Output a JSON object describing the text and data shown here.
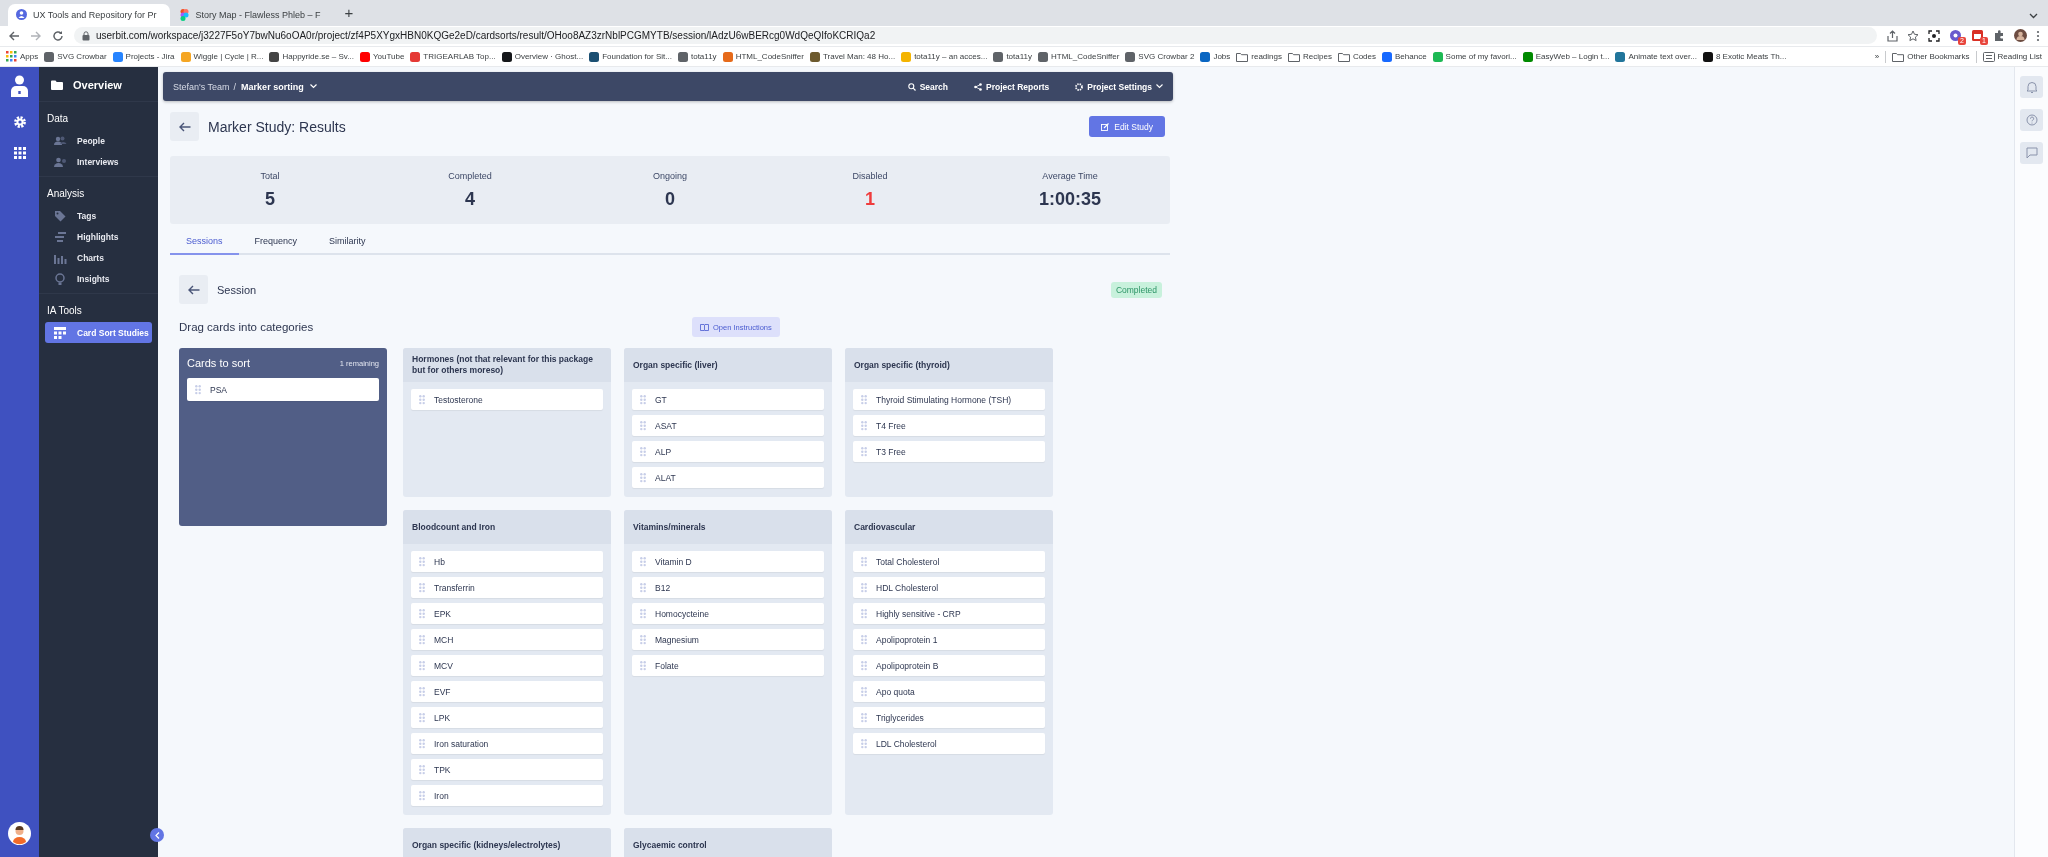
{
  "browser": {
    "tabs": [
      {
        "title": "UX Tools and Repository for Pr",
        "kind": "userbit",
        "selected": true
      },
      {
        "title": "Story Map - Flawless Phleb – F",
        "kind": "figma",
        "selected": false
      }
    ],
    "url": "userbit.com/workspace/j3227F5oY7bwNu6oOA0r/project/zf4P5XYgxHBN0KQGe2eD/cardsorts/result/OHoo8AZ3zrNblPCGMYTB/session/lAdzU6wBERcg0WdQeQIfoKCRIQa2",
    "new_tab": "+",
    "extension_badges": [
      "2",
      "1"
    ],
    "bookmarks": [
      {
        "label": "Apps",
        "kind": "apps"
      },
      {
        "label": "SVG Crowbar",
        "kind": "site",
        "color": "#5f6368"
      },
      {
        "label": "Projects - Jira",
        "kind": "site",
        "color": "#2684ff"
      },
      {
        "label": "Wiggle | Cycle | R...",
        "kind": "site",
        "color": "#f5a623"
      },
      {
        "label": "Happyride.se – Sv...",
        "kind": "site",
        "color": "#444444"
      },
      {
        "label": "YouTube",
        "kind": "site",
        "color": "#ff0000"
      },
      {
        "label": "TRIGEARLAB Top...",
        "kind": "site",
        "color": "#e53935"
      },
      {
        "label": "Overview · Ghost...",
        "kind": "site",
        "color": "#15171a"
      },
      {
        "label": "Foundation for Sit...",
        "kind": "site",
        "color": "#1b4f72"
      },
      {
        "label": "tota11y",
        "kind": "site",
        "color": "#5f6368"
      },
      {
        "label": "HTML_CodeSniffer",
        "kind": "site",
        "color": "#e66a1a"
      },
      {
        "label": "Travel Man: 48 Ho...",
        "kind": "site",
        "color": "#6d5a2e"
      },
      {
        "label": "tota11y – an acces...",
        "kind": "site",
        "color": "#f4b400"
      },
      {
        "label": "tota11y",
        "kind": "site",
        "color": "#5f6368"
      },
      {
        "label": "HTML_CodeSniffer",
        "kind": "site",
        "color": "#5f6368"
      },
      {
        "label": "SVG Crowbar 2",
        "kind": "site",
        "color": "#5f6368"
      },
      {
        "label": "Jobs",
        "kind": "site",
        "color": "#0a66c2"
      },
      {
        "label": "readings",
        "kind": "folder"
      },
      {
        "label": "Recipes",
        "kind": "folder"
      },
      {
        "label": "Codes",
        "kind": "folder"
      },
      {
        "label": "Behance",
        "kind": "site",
        "color": "#1769ff"
      },
      {
        "label": "Some of my favori...",
        "kind": "site",
        "color": "#1db954"
      },
      {
        "label": "EasyWeb – Login t...",
        "kind": "site",
        "color": "#008a00"
      },
      {
        "label": "Animate text over...",
        "kind": "site",
        "color": "#21759b"
      },
      {
        "label": "8 Exotic Meats Th...",
        "kind": "site",
        "color": "#111111"
      }
    ],
    "overflow": "»",
    "other_bookmarks": "Other Bookmarks",
    "reading_list": "Reading List"
  },
  "sidebar": {
    "overview": "Overview",
    "sections": [
      {
        "title": "Data",
        "items": [
          {
            "label": "People",
            "kind": "people",
            "selected": false
          },
          {
            "label": "Interviews",
            "kind": "interviews",
            "selected": false
          }
        ]
      },
      {
        "title": "Analysis",
        "items": [
          {
            "label": "Tags",
            "kind": "tags",
            "selected": false
          },
          {
            "label": "Highlights",
            "kind": "highlights",
            "selected": false
          },
          {
            "label": "Charts",
            "kind": "charts",
            "selected": false
          },
          {
            "label": "Insights",
            "kind": "insights",
            "selected": false
          }
        ]
      },
      {
        "title": "IA Tools",
        "items": [
          {
            "label": "Card Sort Studies",
            "kind": "cardsort",
            "selected": true
          }
        ]
      }
    ]
  },
  "header": {
    "team": "Stefan's Team",
    "separator": "/",
    "project": "Marker sorting",
    "actions": [
      {
        "label": "Search",
        "kind": "search"
      },
      {
        "label": "Project Reports",
        "kind": "share"
      },
      {
        "label": "Project Settings",
        "kind": "settings"
      }
    ]
  },
  "study": {
    "title": "Marker Study: Results",
    "edit_button": "Edit Study"
  },
  "stats": [
    {
      "label": "Total",
      "value": "5",
      "alert": false
    },
    {
      "label": "Completed",
      "value": "4",
      "alert": false
    },
    {
      "label": "Ongoing",
      "value": "0",
      "alert": false
    },
    {
      "label": "Disabled",
      "value": "1",
      "alert": true
    },
    {
      "label": "Average Time",
      "value": "1:00:35",
      "alert": false
    }
  ],
  "tabs": [
    {
      "label": "Sessions",
      "selected": true
    },
    {
      "label": "Frequency",
      "selected": false
    },
    {
      "label": "Similarity",
      "selected": false
    }
  ],
  "session": {
    "title": "Session",
    "status": "Completed",
    "instruction": "Drag cards into categories",
    "instructions_button": "Open Instructions",
    "unsorted": {
      "title": "Cards to sort",
      "remaining": "1 remaining",
      "cards": [
        "PSA"
      ]
    },
    "categories": [
      {
        "title": "Hormones (not that relevant for this package but for others moreso)",
        "cards": [
          "Testosterone"
        ]
      },
      {
        "title": "Organ specific (liver)",
        "cards": [
          "GT",
          "ASAT",
          "ALP",
          "ALAT"
        ]
      },
      {
        "title": "Organ specific (thyroid)",
        "cards": [
          "Thyroid Stimulating Hormone (TSH)",
          "T4 Free",
          "T3 Free"
        ]
      },
      {
        "title": "Bloodcount and Iron",
        "cards": [
          "Hb",
          "Transferrin",
          "EPK",
          "MCH",
          "MCV",
          "EVF",
          "LPK",
          "Iron saturation",
          "TPK",
          "Iron"
        ]
      },
      {
        "title": "Vitamins/minerals",
        "cards": [
          "Vitamin D",
          "B12",
          "Homocycteine",
          "Magnesium",
          "Folate"
        ]
      },
      {
        "title": "Cardiovascular",
        "cards": [
          "Total Cholesterol",
          "HDL Cholesterol",
          "Highly sensitive - CRP",
          "Apolipoprotein 1",
          "Apolipoprotein B",
          "Apo quota",
          "Triglycerides",
          "LDL Cholesterol"
        ]
      },
      {
        "title": "Organ specific (kidneys/electrolytes)"
      },
      {
        "title": "Glycaemic control"
      }
    ]
  }
}
